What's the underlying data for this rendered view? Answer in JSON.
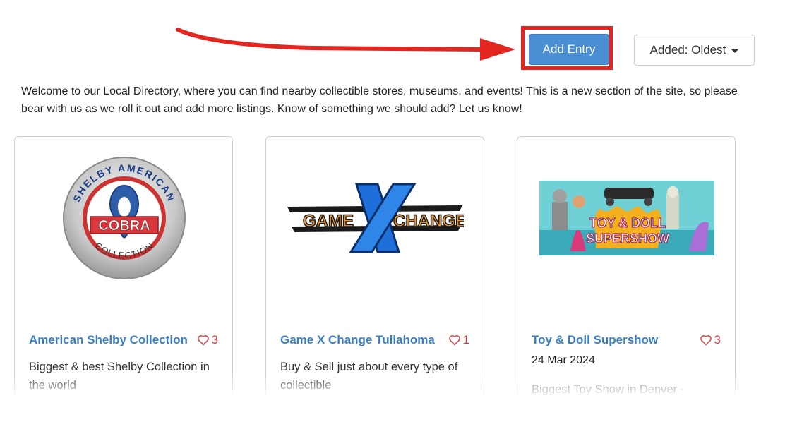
{
  "toolbar": {
    "add_entry_label": "Add Entry",
    "sort_label": "Added: Oldest"
  },
  "intro": {
    "text": "Welcome to our Local Directory, where you can find nearby collectible stores, museums, and events! This is a new section of the site, so please bear with us as we roll it out and add more listings. Know of something we should add? Let us know!"
  },
  "cards": [
    {
      "title": "American Shelby Collection",
      "likes": "3",
      "date": "",
      "description": "Biggest & best Shelby Collection in the world",
      "logo": {
        "ring_top": "SHELBY AMERICAN",
        "ring_bottom": "COLLECTION",
        "banner": "COBRA"
      }
    },
    {
      "title": "Game X Change Tullahoma",
      "likes": "1",
      "date": "",
      "description": "Buy & Sell just about every type of collectible",
      "logo": {
        "left": "GAME",
        "right": "CHANGE"
      }
    },
    {
      "title": "Toy & Doll Supershow",
      "likes": "3",
      "date": "24 Mar 2024",
      "description": "Biggest Toy Show in Denver -",
      "logo": {
        "line1": "TOY & DOLL",
        "line2": "SUPERSHOW"
      }
    }
  ],
  "colors": {
    "accent": "#4a8fd3",
    "link": "#3a7ec4",
    "heart": "#d9363e",
    "annotation": "#e3261f"
  },
  "icons": {
    "heart": "heart-outline-icon",
    "caret": "caret-down-icon",
    "arrow": "annotation-arrow-icon"
  }
}
